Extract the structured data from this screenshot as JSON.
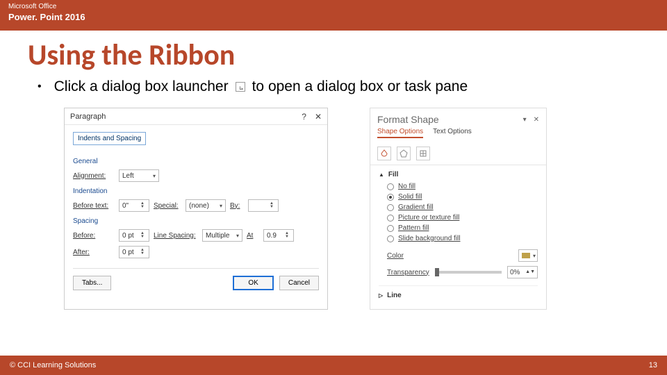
{
  "header": {
    "brand": "Microsoft Office",
    "product": "Power. Point 2016"
  },
  "title": "Using the Ribbon",
  "bullet": {
    "part1": "Click a dialog box launcher",
    "part2": "to open a dialog box or task pane"
  },
  "dialog": {
    "title": "Paragraph",
    "tab": "Indents and Spacing",
    "groups": {
      "general": "General",
      "indentation": "Indentation",
      "spacing": "Spacing"
    },
    "labels": {
      "alignment": "Alignment:",
      "before_text": "Before text:",
      "special": "Special:",
      "by": "By:",
      "before": "Before:",
      "after": "After:",
      "line_spacing": "Line Spacing:",
      "at": "At"
    },
    "values": {
      "alignment": "Left",
      "before_text": "0\"",
      "special": "(none)",
      "by": "",
      "before": "0 pt",
      "after": "0 pt",
      "line_spacing": "Multiple",
      "at": "0.9"
    },
    "buttons": {
      "tabs": "Tabs...",
      "ok": "OK",
      "cancel": "Cancel"
    }
  },
  "pane": {
    "title": "Format Shape",
    "tabs": {
      "shape": "Shape Options",
      "text": "Text Options"
    },
    "fill": {
      "label": "Fill",
      "options": {
        "no_fill": "No fill",
        "solid_fill": "Solid fill",
        "gradient_fill": "Gradient fill",
        "picture_fill": "Picture or texture fill",
        "pattern_fill": "Pattern fill",
        "slide_bg_fill": "Slide background fill"
      },
      "color_label": "Color",
      "transparency_label": "Transparency",
      "transparency_value": "0%"
    },
    "line": {
      "label": "Line"
    }
  },
  "footer": {
    "copyright": "© CCI Learning Solutions",
    "page": "13"
  }
}
